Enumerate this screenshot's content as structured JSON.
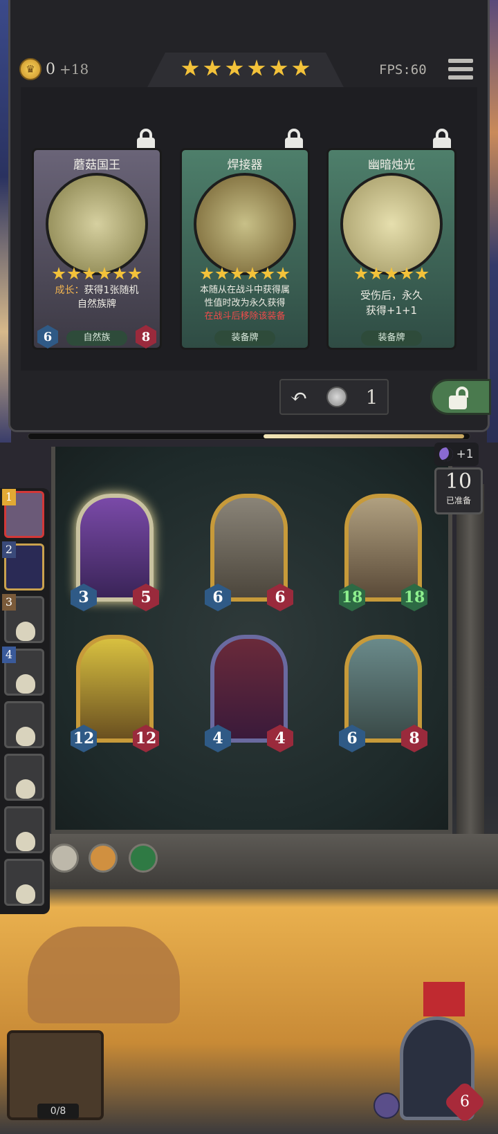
{
  "header": {
    "gold": "0",
    "gold_bonus": "+18",
    "tavern_stars": 6,
    "fps": "FPS:60"
  },
  "shop_cards": [
    {
      "name": "蘑菇国王",
      "stars": 6,
      "desc_highlight": "成长：",
      "desc_line1": "获得1张随机",
      "desc_line2": "自然族牌",
      "desc_red": "",
      "tag": "自然族",
      "attack": "6",
      "health": "8",
      "locked": true
    },
    {
      "name": "焊接器",
      "stars": 6,
      "desc_highlight": "",
      "desc_line1": "本随从在战斗中获得属",
      "desc_line2": "性值时改为永久获得",
      "desc_red": "在战斗后移除该装备",
      "tag": "装备牌",
      "attack": "",
      "health": "",
      "locked": true
    },
    {
      "name": "幽暗烛光",
      "stars": 5,
      "desc_highlight": "",
      "desc_line1": "受伤后，永久",
      "desc_line2": "获得+1+1",
      "desc_red": "",
      "tag": "装备牌",
      "attack": "",
      "health": "",
      "locked": true
    }
  ],
  "shop_controls": {
    "refresh_cost": "1"
  },
  "board_status": {
    "moon_bonus": "+1",
    "ready_count": "10",
    "ready_label": "已准备"
  },
  "minions": [
    {
      "attack": "3",
      "health": "5"
    },
    {
      "attack": "6",
      "health": "6"
    },
    {
      "attack": "18",
      "health": "18"
    },
    {
      "attack": "12",
      "health": "12"
    },
    {
      "attack": "4",
      "health": "4"
    },
    {
      "attack": "6",
      "health": "8"
    }
  ],
  "roster": [
    {
      "rank": "1"
    },
    {
      "rank": "2"
    },
    {
      "rank": "3"
    },
    {
      "rank": "4"
    },
    {
      "rank": ""
    },
    {
      "rank": ""
    },
    {
      "rank": ""
    },
    {
      "rank": ""
    }
  ],
  "hero": {
    "health": "6"
  },
  "deck": {
    "count": "0/8"
  }
}
